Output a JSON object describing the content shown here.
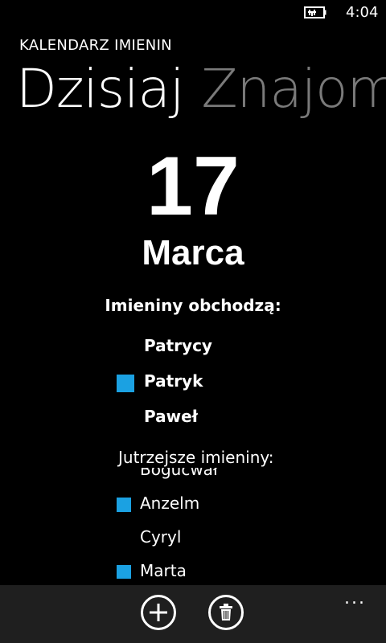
{
  "status": {
    "time": "4:04"
  },
  "app": {
    "title": "KALENDARZ IMIENIN"
  },
  "pivot": {
    "active": "Dzisiaj",
    "inactive": "Znajomi"
  },
  "date": {
    "day": "17",
    "month": "Marca"
  },
  "today": {
    "label": "Imieniny obchodzą:",
    "names": [
      {
        "name": "Patrycy",
        "marked": false
      },
      {
        "name": "Patryk",
        "marked": true
      },
      {
        "name": "Paweł",
        "marked": false
      }
    ]
  },
  "tomorrow": {
    "label": "Jutrzejsze imieniny:",
    "names": [
      {
        "name": "Bogucwał",
        "marked": false
      },
      {
        "name": "Anzelm",
        "marked": true
      },
      {
        "name": "Cyryl",
        "marked": false
      },
      {
        "name": "Marta",
        "marked": true
      }
    ]
  },
  "appbar": {
    "more": "..."
  },
  "colors": {
    "accent": "#1ba1e2",
    "appbar": "#1f1f1f",
    "inactive_pivot": "#7a7a7a"
  }
}
